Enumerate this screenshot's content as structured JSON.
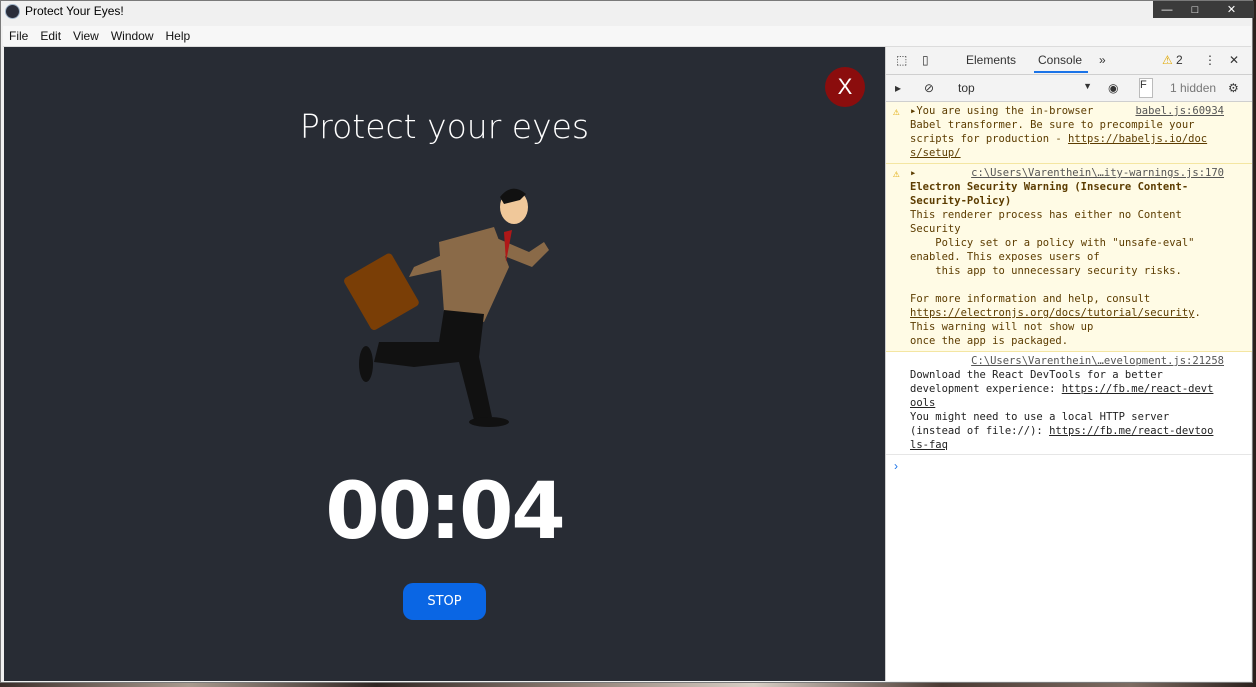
{
  "window": {
    "title": "Protect Your Eyes!",
    "buttons": {
      "minimize": "—",
      "maximize": "□",
      "close": "✕"
    }
  },
  "menu": [
    "File",
    "Edit",
    "View",
    "Window",
    "Help"
  ],
  "app": {
    "close_label": "X",
    "title": "Protect your eyes",
    "timer": "00:04",
    "stop_label": "STOP",
    "colors": {
      "background": "#282c34",
      "close": "#8b0d0d",
      "stop": "#0a66e4"
    }
  },
  "devtools": {
    "tabs": {
      "elements": "Elements",
      "console": "Console",
      "more": "»",
      "warnings": "2"
    },
    "toolbar": {
      "context": "top",
      "filter_placeholder": "F",
      "hidden": "1 hidden"
    },
    "messages": [
      {
        "type": "warn",
        "source": "babel.js:60934",
        "lines": [
          "▸You are using the in-browser",
          "Babel transformer. Be sure to precompile your",
          "scripts for production - ",
          "https://babeljs.io/doc",
          "s/setup/"
        ]
      },
      {
        "type": "warn",
        "source": "c:\\Users\\Varenthein\\…ity-warnings.js:170",
        "bold_lines": [
          "Electron Security Warning (Insecure Content-",
          "Security-Policy)"
        ],
        "text": "This renderer process has either no Content\nSecurity\n    Policy set or a policy with \"unsafe-eval\"\nenabled. This exposes users of\n    this app to unnecessary security risks.\n\nFor more information and help, consult",
        "link": "https://electronjs.org/docs/tutorial/security",
        "tail": ". This warning will not show up\nonce the app is packaged."
      },
      {
        "type": "info",
        "source": "C:\\Users\\Varenthein\\…evelopment.js:21258",
        "text1": "Download the React DevTools for a better\ndevelopment experience: ",
        "link1a": "https://fb.me/react-devt",
        "link1b": "ools",
        "text2": "You might need to use a local HTTP server\n(instead of file://): ",
        "link2a": "https://fb.me/react-devtoo",
        "link2b": "ls-faq"
      }
    ],
    "prompt": "›"
  }
}
